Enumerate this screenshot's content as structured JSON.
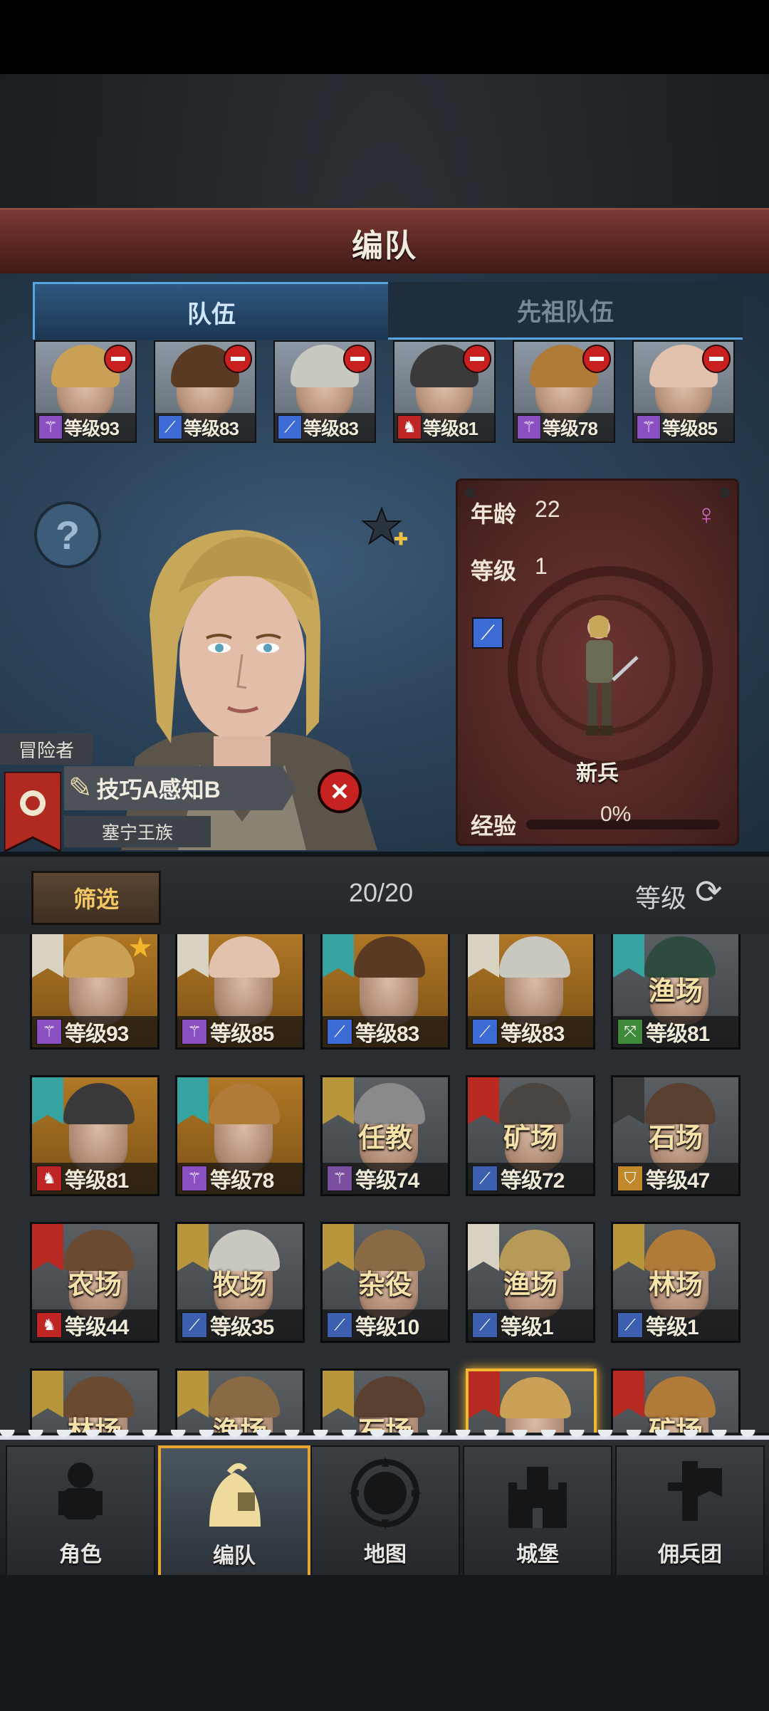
{
  "title": "编队",
  "tabs": [
    {
      "label": "队伍",
      "active": true
    },
    {
      "label": "先祖队伍",
      "active": false
    }
  ],
  "team": [
    {
      "level": "等级93",
      "weapon_icon": "staff-icon",
      "weapon_color": "#8a4fc0",
      "hair": "#c9a055"
    },
    {
      "level": "等级83",
      "weapon_icon": "sword-icon",
      "weapon_color": "#3d6bd6",
      "hair": "#5a3a22"
    },
    {
      "level": "等级83",
      "weapon_icon": "sword-icon",
      "weapon_color": "#3d6bd6",
      "hair": "#c8c8c0"
    },
    {
      "level": "等级81",
      "weapon_icon": "horse-icon",
      "weapon_color": "#c02525",
      "hair": "#3a3a3a"
    },
    {
      "level": "等级78",
      "weapon_icon": "staff-icon",
      "weapon_color": "#8a4fc0",
      "hair": "#b07a38"
    },
    {
      "level": "等级85",
      "weapon_icon": "staff-icon",
      "weapon_color": "#8a4fc0",
      "hair": "#e2c2ad"
    }
  ],
  "selected": {
    "class_label": "冒险者",
    "trait": "技巧A感知B",
    "house": "塞宁王族",
    "age_label": "年龄",
    "age": "22",
    "level_label": "等级",
    "level": "1",
    "unit_name": "新兵",
    "exp_label": "经验",
    "exp_percent": "0%",
    "exp_value": 0
  },
  "filter": {
    "button": "筛选",
    "count": "20/20",
    "sort_label": "等级"
  },
  "roster": [
    {
      "job": "",
      "level": "等级93",
      "bg": "gold",
      "flag": "#d8d2c2",
      "weapon_icon": "staff-icon",
      "weapon_color": "#8a4fc0",
      "hair": "#c9a055",
      "fav": true
    },
    {
      "job": "",
      "level": "等级85",
      "bg": "gold",
      "flag": "#d8d2c2",
      "weapon_icon": "staff-icon",
      "weapon_color": "#8a4fc0",
      "hair": "#e2c2ad"
    },
    {
      "job": "",
      "level": "等级83",
      "bg": "gold",
      "flag": "#35a3a0",
      "weapon_icon": "sword-icon",
      "weapon_color": "#3d6bd6",
      "hair": "#5a3a22"
    },
    {
      "job": "",
      "level": "等级83",
      "bg": "gold",
      "flag": "#d8d2c2",
      "weapon_icon": "sword-icon",
      "weapon_color": "#3d6bd6",
      "hair": "#c8c8c0"
    },
    {
      "job": "渔场",
      "level": "等级81",
      "bg": "gray",
      "flag": "#35a3a0",
      "weapon_icon": "bow-icon",
      "weapon_color": "#3f8a3a",
      "hair": "#2f4a3e"
    },
    {
      "job": "",
      "level": "等级81",
      "bg": "gold",
      "flag": "#35a3a0",
      "weapon_icon": "horse-icon",
      "weapon_color": "#c02525",
      "hair": "#3a3a3a"
    },
    {
      "job": "",
      "level": "等级78",
      "bg": "gold",
      "flag": "#35a3a0",
      "weapon_icon": "staff-icon",
      "weapon_color": "#8a4fc0",
      "hair": "#b07a38"
    },
    {
      "job": "任教",
      "level": "等级74",
      "bg": "gray",
      "flag": "#b8963c",
      "weapon_icon": "staff-icon",
      "weapon_color": "#7a4fa0",
      "hair": "#8a8a8a"
    },
    {
      "job": "矿场",
      "level": "等级72",
      "bg": "gray",
      "flag": "#b82a22",
      "weapon_icon": "sword-icon",
      "weapon_color": "#3d5fb0",
      "hair": "#4a4540"
    },
    {
      "job": "石场",
      "level": "等级47",
      "bg": "gray",
      "flag": "#3a3a3a",
      "weapon_icon": "shield-icon",
      "weapon_color": "#c0882a",
      "hair": "#5a4030"
    },
    {
      "job": "农场",
      "level": "等级44",
      "bg": "gray",
      "flag": "#b82a22",
      "weapon_icon": "horse-icon",
      "weapon_color": "#c02525",
      "hair": "#6a4a30"
    },
    {
      "job": "牧场",
      "level": "等级35",
      "bg": "gray",
      "flag": "#b8963c",
      "weapon_icon": "sword-icon",
      "weapon_color": "#3d5fb0",
      "hair": "#c8c8c0"
    },
    {
      "job": "杂役",
      "level": "等级10",
      "bg": "gray",
      "flag": "#b8963c",
      "weapon_icon": "sword-icon",
      "weapon_color": "#3d5fb0",
      "hair": "#8a6a45"
    },
    {
      "job": "渔场",
      "level": "等级1",
      "bg": "gray",
      "flag": "#d8d2c2",
      "weapon_icon": "sword-icon",
      "weapon_color": "#3d5fb0",
      "hair": "#b89a58"
    },
    {
      "job": "林场",
      "level": "等级1",
      "bg": "gray",
      "flag": "#b8963c",
      "weapon_icon": "sword-icon",
      "weapon_color": "#3d5fb0",
      "hair": "#b07a38"
    },
    {
      "job": "林场",
      "level": "",
      "bg": "gray",
      "flag": "#b8963c",
      "weapon_icon": "",
      "weapon_color": "#3d5fb0",
      "hair": "#6a4a30"
    },
    {
      "job": "渔场",
      "level": "",
      "bg": "gray",
      "flag": "#b8963c",
      "weapon_icon": "",
      "weapon_color": "#3d5fb0",
      "hair": "#8a6a45"
    },
    {
      "job": "石场",
      "level": "",
      "bg": "gray",
      "flag": "#b8963c",
      "weapon_icon": "",
      "weapon_color": "#3d5fb0",
      "hair": "#5a4030"
    },
    {
      "job": "",
      "level": "",
      "bg": "gray",
      "flag": "#b82a22",
      "weapon_icon": "",
      "weapon_color": "#3d5fb0",
      "hair": "#c9a055",
      "selected": true
    },
    {
      "job": "矿场",
      "level": "",
      "bg": "gray",
      "flag": "#b82a22",
      "weapon_icon": "",
      "weapon_color": "#3d5fb0",
      "hair": "#b07a38"
    }
  ],
  "nav": [
    {
      "label": "角色",
      "icon": "knight-icon",
      "active": false
    },
    {
      "label": "编队",
      "icon": "helmet-icon",
      "active": true
    },
    {
      "label": "地图",
      "icon": "compass-map-icon",
      "active": false
    },
    {
      "label": "城堡",
      "icon": "castle-icon",
      "active": false
    },
    {
      "label": "佣兵团",
      "icon": "sword-banner-icon",
      "active": false
    }
  ],
  "colors": {
    "accent_tab": "#5aa4e0",
    "nav_active_border": "#e8a52d",
    "job_text": "#f6e2a8"
  }
}
